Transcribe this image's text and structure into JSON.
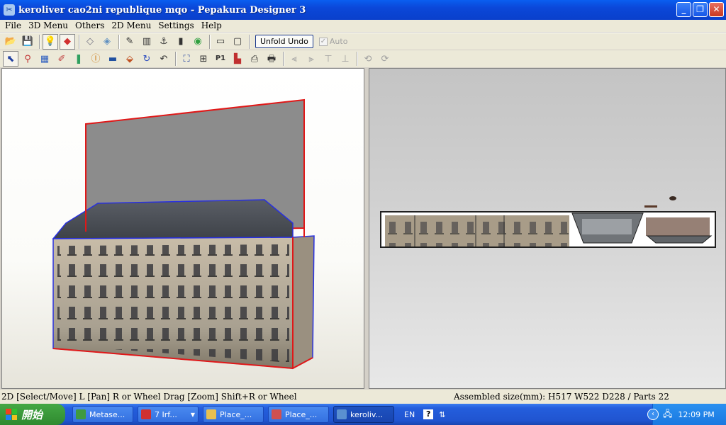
{
  "window": {
    "title": "keroliver cao2ni republique mqo - Pepakura Designer 3",
    "icon": "pepakura-app-icon",
    "controls": [
      "minimize",
      "maximize",
      "close"
    ]
  },
  "menu": [
    "File",
    "3D Menu",
    "Others",
    "2D Menu",
    "Settings",
    "Help"
  ],
  "toolbar": {
    "unfold_undo_label": "Unfold Undo",
    "auto_label": "Auto",
    "auto_checked": true,
    "auto_enabled": false
  },
  "status": {
    "left": "2D [Select/Move] L [Pan] R or Wheel Drag [Zoom] Shift+R or Wheel",
    "right": "Assembled size(mm): H517 W522 D228 / Parts 22"
  },
  "taskbar": {
    "start_label": "開始",
    "tasks": [
      {
        "label": "Metase...",
        "icon": "leaf-icon",
        "color": "#3f9a3f"
      },
      {
        "label": "7 Irf...",
        "icon": "puzzle-icon",
        "color": "#d03030"
      },
      {
        "label": "Place_...",
        "icon": "folder-icon",
        "color": "#e8c050"
      },
      {
        "label": "Place_...",
        "icon": "pencil-icon",
        "color": "#d05050"
      },
      {
        "label": "keroliv...",
        "icon": "pepakura-icon",
        "color": "#5a90d0"
      }
    ],
    "active_task": "keroliv...",
    "language": "EN",
    "clock": "12:09 PM"
  },
  "colors": {
    "titlebar": "#0b47d8",
    "edge_red": "#e01818",
    "edge_blue": "#2830e0"
  }
}
